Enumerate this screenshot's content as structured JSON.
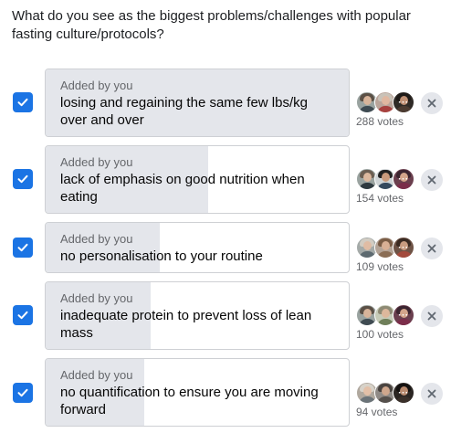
{
  "question": "What do you see as the biggest problems/challenges with popular fasting culture/protocols?",
  "options": [
    {
      "added_by": "Added by you",
      "text": "losing and regaining the same few lbs/kg over and over",
      "votes": "288 votes",
      "vote_share": 1.0,
      "checked": true
    },
    {
      "added_by": "Added by you",
      "text": "lack of emphasis on good nutrition when eating",
      "votes": "154 votes",
      "vote_share": 0.535,
      "checked": true
    },
    {
      "added_by": "Added by you",
      "text": "no personalisation to your routine",
      "votes": "109 votes",
      "vote_share": 0.378,
      "checked": true
    },
    {
      "added_by": "Added by you",
      "text": "inadequate protein to prevent loss of lean mass",
      "votes": "100 votes",
      "vote_share": 0.347,
      "checked": true
    },
    {
      "added_by": "Added by you",
      "text": "no quantification to ensure you are moving forward",
      "votes": "94 votes",
      "vote_share": 0.326,
      "checked": true
    }
  ],
  "colors": {
    "checkbox": "#1b74e4",
    "bar_fill": "#e4e6eb",
    "border": "#ced0d4",
    "secondary_text": "#65676b"
  }
}
